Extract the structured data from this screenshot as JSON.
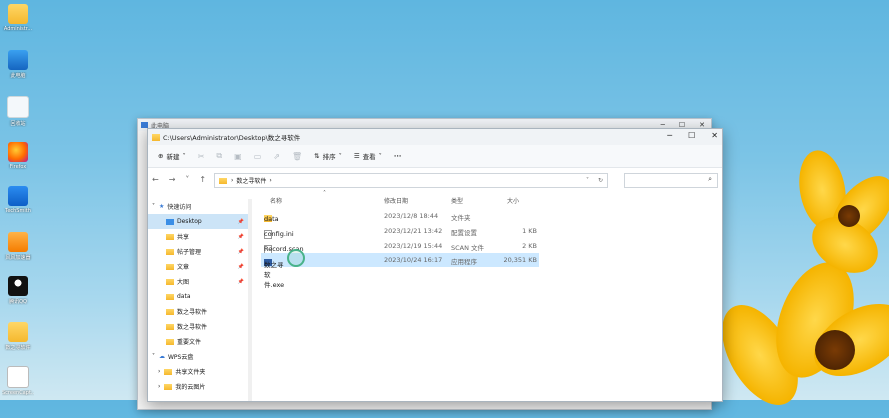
{
  "desktop": {
    "icons": [
      {
        "label": "Administr...",
        "icon": "folder-icon"
      },
      {
        "label": "此电脑",
        "icon": "computer-icon"
      },
      {
        "label": "回收站",
        "icon": "recycle-bin-icon"
      },
      {
        "label": "Firefox",
        "icon": "firefox-icon"
      },
      {
        "label": "TechSmith",
        "icon": "techsmith-icon"
      },
      {
        "label": "风风加速器",
        "icon": "app-icon"
      },
      {
        "label": "腾讯QQ",
        "icon": "qq-icon"
      },
      {
        "label": "数之寻软件",
        "icon": "folder-icon"
      },
      {
        "label": "ScreenCapt...",
        "icon": "document-icon"
      }
    ]
  },
  "back_window": {
    "title": "此电脑",
    "controls": [
      "─",
      "☐",
      "✕"
    ]
  },
  "window": {
    "title": "C:\\Users\\Administrator\\Desktop\\数之寻软件",
    "controls": [
      "─",
      "☐",
      "✕"
    ],
    "toolbar": {
      "new_label": "新建",
      "sort_label": "排序",
      "view_label": "查看",
      "more_label": "···"
    },
    "address": {
      "crumbs": [
        "数之寻软件"
      ],
      "sep": "›"
    },
    "search": {
      "placeholder": ""
    },
    "nav": {
      "quick_access": "快速访问",
      "items": [
        {
          "label": "Desktop",
          "pinned": true,
          "selected": false
        },
        {
          "label": "共享",
          "pinned": true,
          "selected": false
        },
        {
          "label": "帖子管理",
          "pinned": true,
          "selected": false
        },
        {
          "label": "文章",
          "pinned": true,
          "selected": false
        },
        {
          "label": "大图",
          "pinned": true,
          "selected": false
        },
        {
          "label": "data",
          "pinned": false,
          "selected": false
        },
        {
          "label": "数之寻软件",
          "pinned": false,
          "selected": false
        },
        {
          "label": "数之寻软件",
          "pinned": false,
          "selected": false
        },
        {
          "label": "重要文件",
          "pinned": false,
          "selected": false
        }
      ],
      "wps": "WPS云盘",
      "wps_items": [
        "共享文件夹",
        "我的云图片"
      ]
    },
    "columns": {
      "name": "名称",
      "date": "修改日期",
      "type": "类型",
      "size": "大小"
    },
    "files": [
      {
        "name": "data",
        "date": "2023/12/8 18:44",
        "type": "文件夹",
        "size": "",
        "kind": "folder"
      },
      {
        "name": "config.ini",
        "date": "2023/12/21 13:42",
        "type": "配置设置",
        "size": "1 KB",
        "kind": "file"
      },
      {
        "name": "Record.scan",
        "date": "2023/12/19 15:44",
        "type": "SCAN 文件",
        "size": "2 KB",
        "kind": "file"
      },
      {
        "name": "数之寻软件.exe",
        "date": "2023/10/24 16:17",
        "type": "应用程序",
        "size": "20,351 KB",
        "kind": "exe"
      }
    ]
  }
}
